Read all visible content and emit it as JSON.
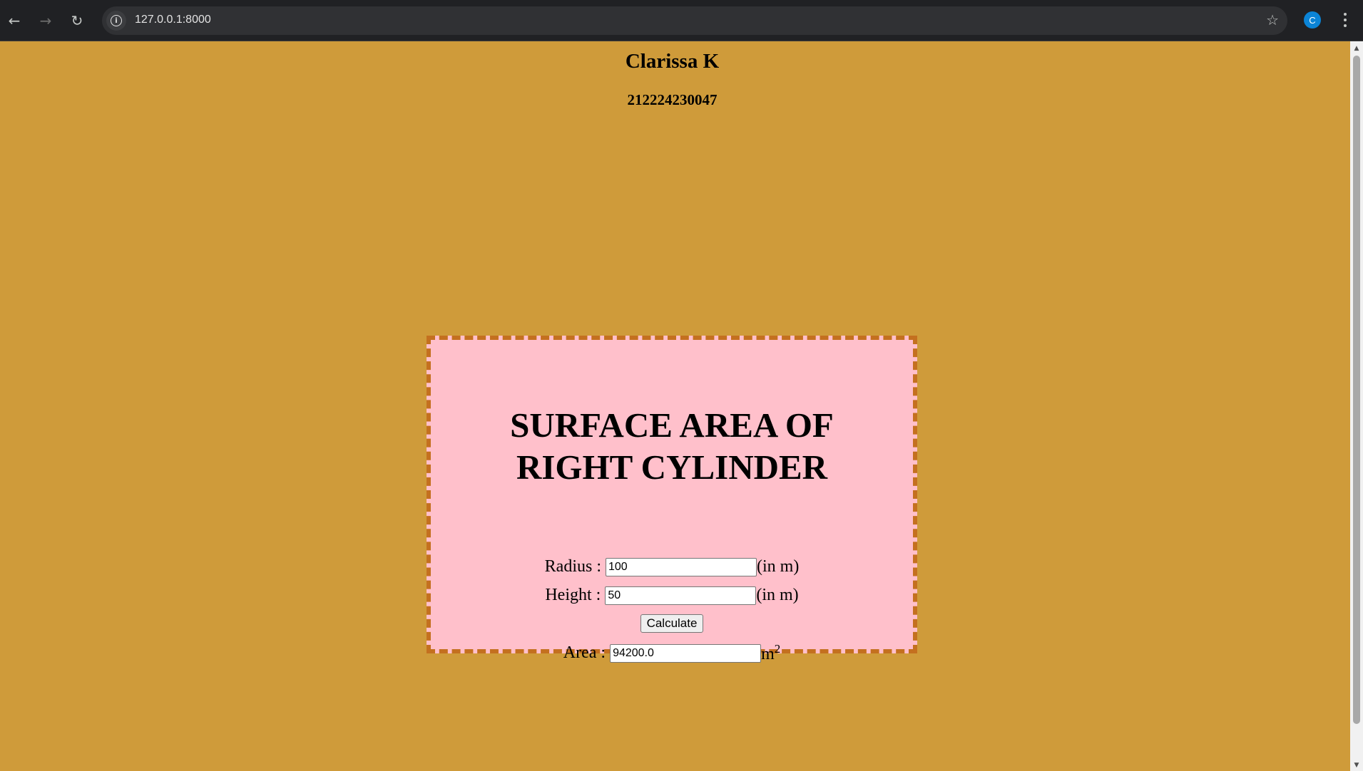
{
  "browser": {
    "url": "127.0.0.1:8000",
    "profile_initial": "C",
    "icons": {
      "back": "arrow-left-icon",
      "forward": "arrow-right-icon",
      "reload": "reload-icon",
      "site_info": "info-icon",
      "bookmark": "star-icon",
      "menu": "kebab-menu-icon"
    }
  },
  "header": {
    "name": "Clarissa K",
    "roll_number": "212224230047"
  },
  "calculator": {
    "title_line1": "SURFACE AREA OF",
    "title_line2": "RIGHT CYLINDER",
    "radius": {
      "label": "Radius :",
      "value": "100",
      "unit": "(in m)"
    },
    "height": {
      "label": "Height :",
      "value": "50",
      "unit": "(in m)"
    },
    "calculate_label": "Calculate",
    "area": {
      "label": "Area :",
      "value": "94200.0",
      "unit_base": "m",
      "unit_exp": "2"
    }
  },
  "colors": {
    "page_background": "#cf9b3a",
    "card_background": "#ffc0cb",
    "card_border": "#c4701f"
  }
}
